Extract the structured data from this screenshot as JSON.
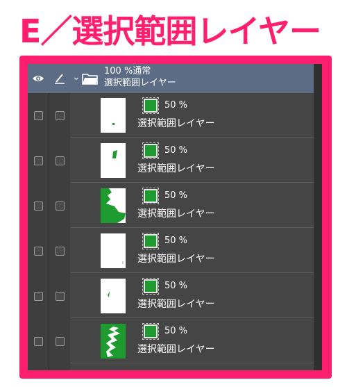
{
  "heading": "E／選択範囲レイヤー",
  "folder": {
    "opacity_mode": "100 %通常",
    "name": "選択範囲レイヤー"
  },
  "layers": [
    {
      "opacity": "50 %",
      "name": "選択範囲レイヤー"
    },
    {
      "opacity": "50 %",
      "name": "選択範囲レイヤー"
    },
    {
      "opacity": "50 %",
      "name": "選択範囲レイヤー"
    },
    {
      "opacity": "50 %",
      "name": "選択範囲レイヤー"
    },
    {
      "opacity": "50 %",
      "name": "選択範囲レイヤー"
    },
    {
      "opacity": "50 %",
      "name": "選択範囲レイヤー"
    }
  ],
  "colors": {
    "accent": "#ff1f6e",
    "panel": "#454545",
    "header": "#5c6c85",
    "mask_green": "#1e9b2f"
  },
  "icons": [
    "eye-icon",
    "pen-icon",
    "chevron-down-icon",
    "folder-icon",
    "selection-mask-icon"
  ]
}
